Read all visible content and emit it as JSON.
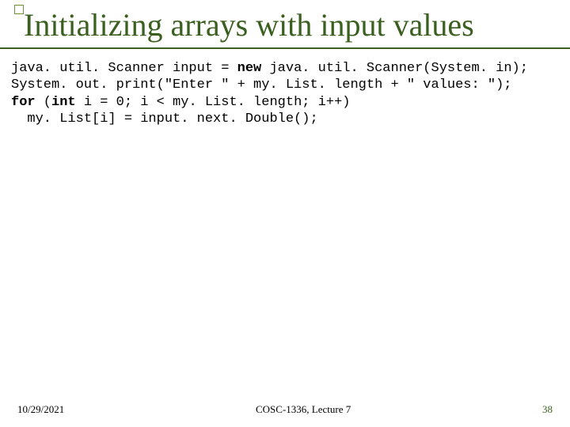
{
  "title": "Initializing arrays with input values",
  "code": {
    "l1a": "java. util. Scanner input = ",
    "l1_kw": "new",
    "l1b": " java. util. Scanner(System. in);",
    "l2": "System. out. print(\"Enter \" + my. List. length + \" values: \");",
    "l3_kw1": "for",
    "l3a": " (",
    "l3_kw2": "int",
    "l3b": " i = 0; i < my. List. length; i++)",
    "l4": "  my. List[i] = input. next. Double();"
  },
  "footer": {
    "date": "10/29/2021",
    "course": "COSC-1336, Lecture 7",
    "page": "38"
  }
}
